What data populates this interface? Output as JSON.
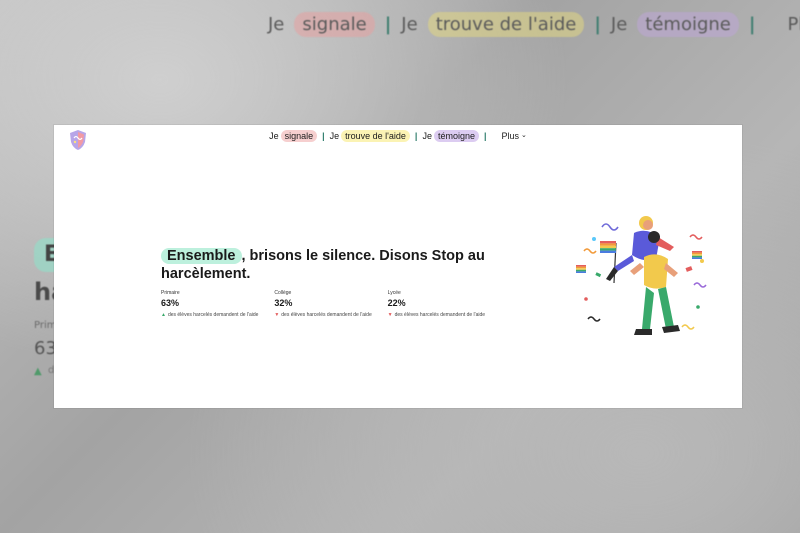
{
  "nav": {
    "items": [
      {
        "prefix": "Je",
        "label": "signale",
        "color": "#f6cfcf"
      },
      {
        "prefix": "Je",
        "label": "trouve de l'aide",
        "color": "#fbf3b4"
      },
      {
        "prefix": "Je",
        "label": "témoigne",
        "color": "#dcccf1"
      }
    ],
    "more_label": "Plus",
    "more_icon": "chevron-down-icon"
  },
  "background": {
    "hero_first_letter": "E",
    "hero_partial": "ha",
    "stat_label_partial": "Prim",
    "stat_value": "63",
    "desc_partial": "d"
  },
  "hero": {
    "highlight": "Ensemble",
    "headline_rest": ", brisons le silence. Disons Stop au harcèlement.",
    "highlight_color": "#bdf0dd"
  },
  "stats": [
    {
      "label": "Primaire",
      "value": "63%",
      "trend": "up",
      "description": "des élèves harcelés demandent de l'aide"
    },
    {
      "label": "Collège",
      "value": "32%",
      "trend": "down",
      "description": "des élèves harcelés demandent de l'aide"
    },
    {
      "label": "Lycée",
      "value": "22%",
      "trend": "down",
      "description": "des élèves harcelés demandent de l'aide"
    }
  ],
  "colors": {
    "separator": "#2f7d6d",
    "trend_up": "#39a96b",
    "trend_down": "#e35d5d"
  }
}
